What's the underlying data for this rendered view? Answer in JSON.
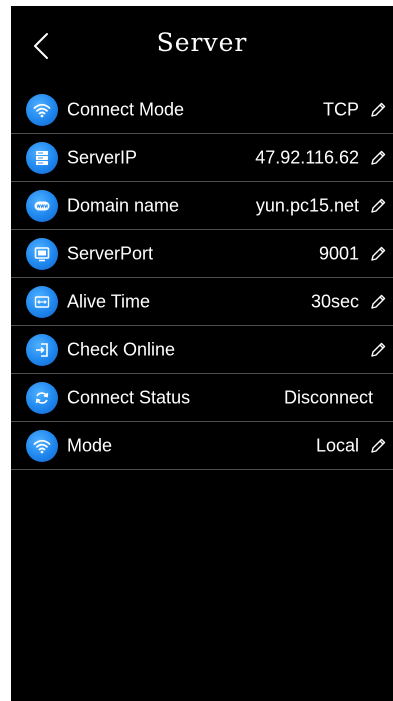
{
  "header": {
    "title": "Server",
    "back_icon": "chevron-left-icon"
  },
  "colors": {
    "background": "#000000",
    "text": "#ffffff",
    "icon_bg": "#1e86ee",
    "divider": "#4d4d4d"
  },
  "settings": [
    {
      "label": "Connect Mode",
      "value": "TCP",
      "icon": "wifi-icon",
      "editable": true
    },
    {
      "label": "ServerIP",
      "value": "47.92.116.62",
      "icon": "server-icon",
      "editable": true
    },
    {
      "label": "Domain name",
      "value": "yun.pc15.net",
      "icon": "www-icon",
      "editable": true
    },
    {
      "label": "ServerPort",
      "value": "9001",
      "icon": "monitor-icon",
      "editable": true
    },
    {
      "label": "Alive Time",
      "value": "30sec",
      "icon": "interval-icon",
      "editable": true
    },
    {
      "label": "Check Online",
      "value": "",
      "icon": "check-in-icon",
      "editable": true
    },
    {
      "label": "Connect Status",
      "value": "Disconnect",
      "icon": "refresh-icon",
      "editable": false
    },
    {
      "label": "Mode",
      "value": "Local",
      "icon": "wifi-icon",
      "editable": true
    }
  ]
}
